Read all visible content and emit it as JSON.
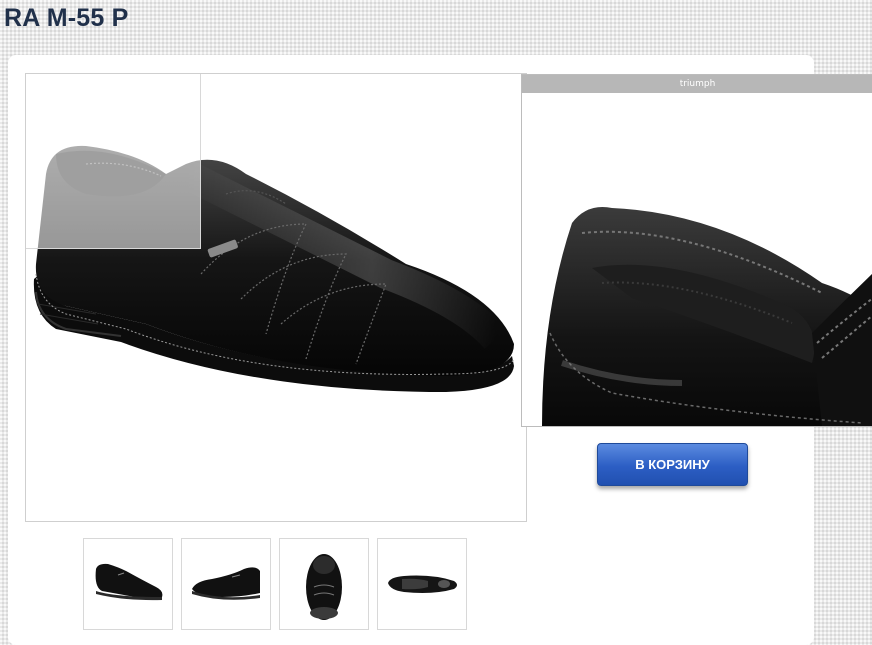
{
  "product": {
    "title": "RA M-55 P"
  },
  "gallery": {
    "zoom_caption": "triumph",
    "thumbnails": [
      {
        "view": "side-left"
      },
      {
        "view": "side-right"
      },
      {
        "view": "front"
      },
      {
        "view": "sole"
      }
    ]
  },
  "actions": {
    "add_to_cart_label": "В КОРЗИНУ"
  },
  "colors": {
    "title": "#20304a",
    "button": "#2c5ec4",
    "zoom_bar": "#b7b7b7"
  }
}
